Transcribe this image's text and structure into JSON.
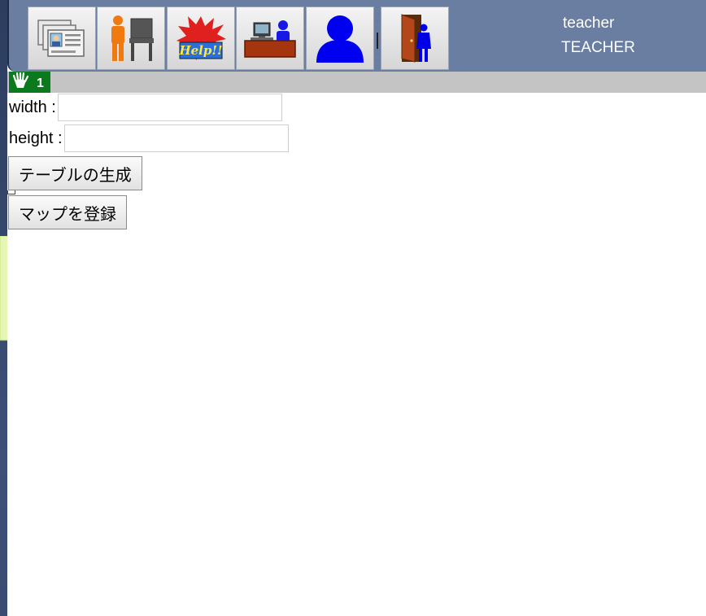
{
  "toolbar": {
    "buttons": [
      {
        "name": "student-cards-button",
        "icon": "student-cards-icon"
      },
      {
        "name": "seat-assign-button",
        "icon": "person-chair-icon"
      },
      {
        "name": "help-button",
        "icon": "help-burst-icon"
      },
      {
        "name": "teacher-desk-button",
        "icon": "teacher-desk-icon"
      },
      {
        "name": "user-profile-button",
        "icon": "user-silhouette-icon"
      },
      {
        "name": "logout-button",
        "icon": "door-exit-icon"
      }
    ]
  },
  "user": {
    "name": "teacher",
    "role": "TEACHER"
  },
  "status": {
    "hand_icon": "raised-hand-icon",
    "raised_count": "1"
  },
  "form": {
    "width_label": "width :",
    "width_value": "",
    "height_label": "height :",
    "height_value": "",
    "generate_table_label": "テーブルの生成",
    "register_map_label": "マップを登録"
  },
  "colors": {
    "toolbar_bg": "#6a7ea1",
    "status_strip": "#c4c4c4",
    "badge_green": "#0b7a1c",
    "desktop_bg": "#34476b"
  }
}
